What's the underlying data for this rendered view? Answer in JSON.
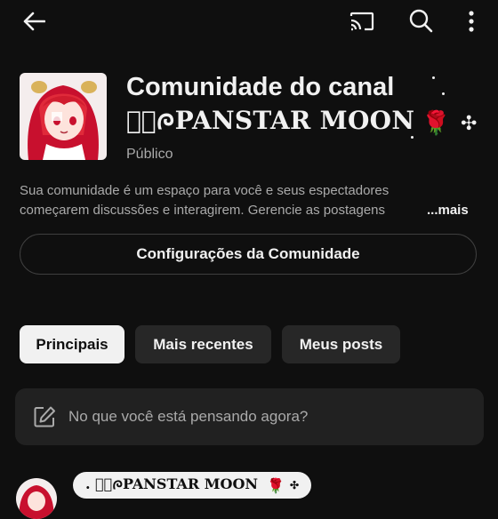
{
  "header": {
    "back_icon": "arrow-left-icon",
    "cast_icon": "cast-icon",
    "search_icon": "search-icon",
    "more_icon": "more-vert-icon"
  },
  "community": {
    "title_line1": "Comunidade do canal",
    "title_line2": "ꪜ᪶ᰍPANSTAR MOON",
    "title_emoji": "🌹",
    "title_sparkle": "✣",
    "visibility": "Público",
    "description_line1": "Sua comunidade é um espaço para você e seus espectadores",
    "description_line2": "começarem discussões e interagirem. Gerencie as postagens",
    "more_label": "...mais",
    "settings_button": "Configurações da Comunidade"
  },
  "tabs": [
    {
      "label": "Principais",
      "active": true
    },
    {
      "label": "Mais recentes",
      "active": false
    },
    {
      "label": "Meus posts",
      "active": false
    }
  ],
  "composer": {
    "icon": "edit-icon",
    "placeholder": "No que você está pensando agora?"
  },
  "post": {
    "author": ". ꪜ᪶ᰍPANSTAR MOON",
    "author_emoji": "🌹",
    "author_sparkle": "✣"
  },
  "colors": {
    "background": "#0f0f0f",
    "text_primary": "#f1f1f1",
    "text_secondary": "#aaaaaa",
    "chip_inactive": "#272727",
    "composer_bg": "#212121",
    "outline": "#3f3f3f"
  }
}
